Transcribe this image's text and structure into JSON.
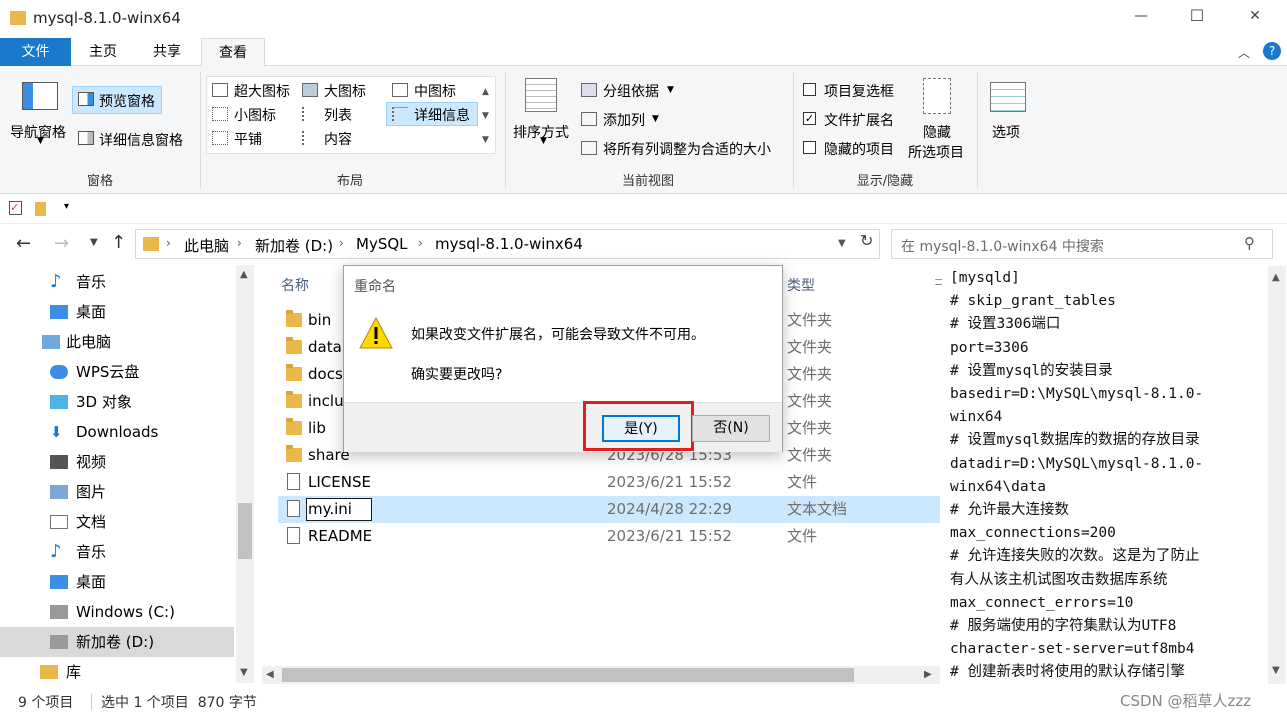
{
  "window": {
    "title": "mysql-8.1.0-winx64",
    "controls": {
      "minimize": "—",
      "maximize": "☐",
      "close": "✕"
    }
  },
  "ribbon_tabs": [
    {
      "label": "文件"
    },
    {
      "label": "主页"
    },
    {
      "label": "共享"
    },
    {
      "label": "查看"
    }
  ],
  "ribbon": {
    "panes": {
      "nav_pane": "导航窗格",
      "preview_pane": "预览窗格",
      "details_pane": "详细信息窗格",
      "group": "窗格"
    },
    "layout": {
      "items": [
        "超大图标",
        "大图标",
        "中图标",
        "小图标",
        "列表",
        "详细信息",
        "平铺",
        "内容"
      ],
      "group": "布局"
    },
    "current_view": {
      "sort_by": "排序方式",
      "group_by": "分组依据",
      "add_column": "添加列",
      "fit_columns": "将所有列调整为合适的大小",
      "group": "当前视图"
    },
    "show_hide": {
      "item_checkboxes": "项目复选框",
      "file_extensions": "文件扩展名",
      "hidden_items": "隐藏的项目",
      "hide_selected_1": "隐藏",
      "hide_selected_2": "所选项目",
      "group": "显示/隐藏",
      "options": "选项"
    }
  },
  "address": {
    "breadcrumb": [
      "此电脑",
      "新加卷 (D:)",
      "MySQL",
      "mysql-8.1.0-winx64"
    ],
    "search_placeholder": "在 mysql-8.1.0-winx64 中搜索"
  },
  "nav_items": [
    {
      "label": "音乐",
      "icon": "music-icon"
    },
    {
      "label": "桌面",
      "icon": "desktop-icon"
    },
    {
      "label": "此电脑",
      "icon": "computer-icon"
    },
    {
      "label": "WPS云盘",
      "icon": "cloud-icon"
    },
    {
      "label": "3D 对象",
      "icon": "3d-objects-icon"
    },
    {
      "label": "Downloads",
      "icon": "download-icon"
    },
    {
      "label": "视频",
      "icon": "video-icon"
    },
    {
      "label": "图片",
      "icon": "pictures-icon"
    },
    {
      "label": "文档",
      "icon": "documents-icon"
    },
    {
      "label": "音乐",
      "icon": "music-icon"
    },
    {
      "label": "桌面",
      "icon": "desktop-icon"
    },
    {
      "label": "Windows (C:)",
      "icon": "drive-icon"
    },
    {
      "label": "新加卷 (D:)",
      "icon": "drive-icon"
    },
    {
      "label": "库",
      "icon": "library-icon"
    }
  ],
  "columns": {
    "name": "名称",
    "type": "类型"
  },
  "files": [
    {
      "name": "bin",
      "date": "",
      "type": "文件夹",
      "kind": "folder"
    },
    {
      "name": "data",
      "date": "",
      "type": "文件夹",
      "kind": "folder"
    },
    {
      "name": "docs",
      "date": "",
      "type": "文件夹",
      "kind": "folder"
    },
    {
      "name": "inclu",
      "date": "",
      "type": "文件夹",
      "kind": "folder"
    },
    {
      "name": "lib",
      "date": "",
      "type": "文件夹",
      "kind": "folder"
    },
    {
      "name": "share",
      "date": "2023/6/28 15:53",
      "type": "文件夹",
      "kind": "folder"
    },
    {
      "name": "LICENSE",
      "date": "2023/6/21 15:52",
      "type": "文件",
      "kind": "file"
    },
    {
      "name": "my.ini",
      "date": "2024/4/28 22:29",
      "type": "文本文档",
      "kind": "file"
    },
    {
      "name": "README",
      "date": "2023/6/21 15:52",
      "type": "文件",
      "kind": "file"
    }
  ],
  "preview_lines": [
    "[mysqld]",
    "# skip_grant_tables",
    "# 设置3306端口",
    "port=3306",
    "# 设置mysql的安装目录",
    "basedir=D:\\MySQL\\mysql-8.1.0-",
    "winx64",
    "# 设置mysql数据库的数据的存放目录",
    "datadir=D:\\MySQL\\mysql-8.1.0-",
    "winx64\\data",
    "# 允许最大连接数",
    "max_connections=200",
    "# 允许连接失败的次数。这是为了防止",
    "有人从该主机试图攻击数据库系统",
    "max_connect_errors=10",
    "# 服务端使用的字符集默认为UTF8",
    "character-set-server=utf8mb4",
    "# 创建新表时将使用的默认存储引擎"
  ],
  "status": {
    "count": "9 个项目",
    "selected": "选中 1 个项目  870 字节",
    "watermark": "CSDN @稻草人zzz"
  },
  "dialog": {
    "title": "重命名",
    "line1": "如果改变文件扩展名，可能会导致文件不可用。",
    "line2": "确实要更改吗?",
    "yes": "是(Y)",
    "no": "否(N)"
  },
  "colors": {
    "accent": "#1979ca",
    "selection": "#cce8ff",
    "highlight_box": "#e02020"
  }
}
